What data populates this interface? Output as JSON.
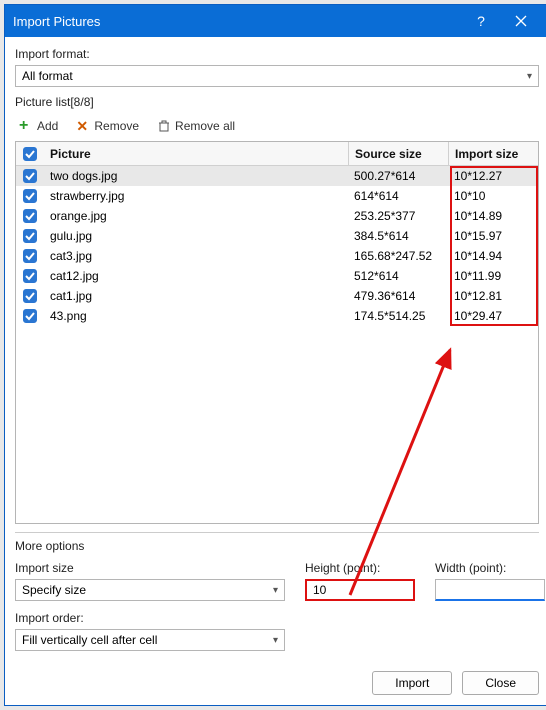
{
  "window": {
    "title": "Import Pictures"
  },
  "importFormat": {
    "label": "Import format:",
    "value": "All format"
  },
  "pictureList": {
    "label": "Picture list[8/8]"
  },
  "toolbar": {
    "add": "Add",
    "remove": "Remove",
    "removeAll": "Remove all"
  },
  "columns": {
    "picture": "Picture",
    "source": "Source size",
    "import": "Import size"
  },
  "rows": [
    {
      "name": "two dogs.jpg",
      "source": "500.27*614",
      "import": "10*12.27",
      "selected": true
    },
    {
      "name": "strawberry.jpg",
      "source": "614*614",
      "import": "10*10"
    },
    {
      "name": "orange.jpg",
      "source": "253.25*377",
      "import": "10*14.89"
    },
    {
      "name": "gulu.jpg",
      "source": "384.5*614",
      "import": "10*15.97"
    },
    {
      "name": "cat3.jpg",
      "source": "165.68*247.52",
      "import": "10*14.94"
    },
    {
      "name": "cat12.jpg",
      "source": "512*614",
      "import": "10*11.99"
    },
    {
      "name": "cat1.jpg",
      "source": "479.36*614",
      "import": "10*12.81"
    },
    {
      "name": "43.png",
      "source": "174.5*514.25",
      "import": "10*29.47"
    }
  ],
  "more": {
    "label": "More options",
    "importSize": {
      "label": "Import size",
      "value": "Specify size"
    },
    "height": {
      "label": "Height (point):",
      "value": "10"
    },
    "width": {
      "label": "Width (point):",
      "value": ""
    },
    "importOrder": {
      "label": "Import order:",
      "value": "Fill vertically cell after cell"
    }
  },
  "buttons": {
    "import": "Import",
    "close": "Close"
  }
}
